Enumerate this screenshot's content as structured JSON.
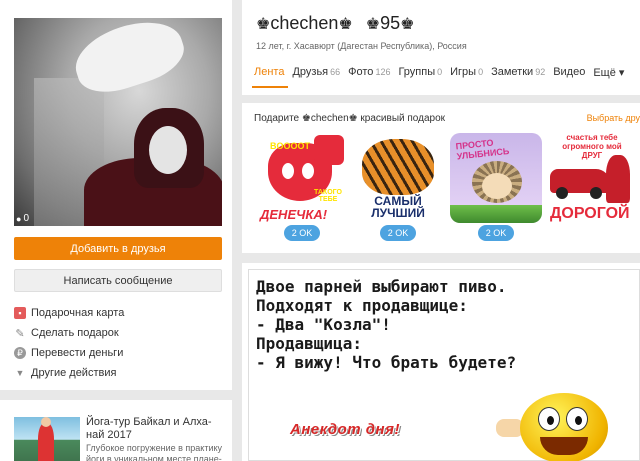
{
  "profile_photo": {
    "photo_count": "0"
  },
  "left_panel": {
    "add_friend_label": "Добавить в друзья",
    "write_message_label": "Написать сообщение",
    "actions": [
      {
        "label": "Подарочная карта",
        "icon": "gift-card-icon"
      },
      {
        "label": "Сделать подарок",
        "icon": "pencil-icon"
      },
      {
        "label": "Перевести деньги",
        "icon": "coin-icon"
      },
      {
        "label": "Другие действия",
        "icon": "chevron-down-icon"
      }
    ]
  },
  "ad": {
    "title": "Йога-тур Байкал и Алха-най 2017",
    "description": "Глубокое погружение в практику йоги в уникальном месте плане-"
  },
  "user": {
    "crown": "♚",
    "name": "chechen",
    "age_number": "95",
    "info": "12 лет, г. Хасавюрт (Дагестан Республика), Россия"
  },
  "nav": {
    "tabs": [
      {
        "label": "Лента",
        "count": ""
      },
      {
        "label": "Друзья",
        "count": "66"
      },
      {
        "label": "Фото",
        "count": "126"
      },
      {
        "label": "Группы",
        "count": "0"
      },
      {
        "label": "Игры",
        "count": "0"
      },
      {
        "label": "Заметки",
        "count": "92"
      },
      {
        "label": "Видео",
        "count": ""
      },
      {
        "label": "Ещё ▾",
        "count": ""
      }
    ]
  },
  "gifts": {
    "heading_prefix": "Подарите ",
    "heading_crown": "♚",
    "heading_name": "chechen",
    "heading_suffix": " красивый подарок",
    "choose_label": "Выбрать дру",
    "items": [
      {
        "top": "BOOOOT",
        "middle": "ТАКОГО ТЕБЕ",
        "bottom": "ДЕНЕЧКА!",
        "price": "2 OK"
      },
      {
        "top": "",
        "middle": "САМЫЙ",
        "bottom": "ЛУЧШИЙ",
        "price": "2 OK"
      },
      {
        "top": "ПРОСТО УЛЫБНИСЬ",
        "middle": "",
        "bottom": "",
        "price": "2 OK"
      },
      {
        "top": "счастья тебе огромного мой ДРУГ",
        "middle": "",
        "bottom": "ДОРОГОЙ",
        "price": ""
      }
    ]
  },
  "post": {
    "lines": [
      "Двое парней выбирают пиво.",
      "Подходят к продавщице:",
      "- Два \"Козла\"!",
      "Продавщица:",
      "- Я вижу! Что брать будете?"
    ],
    "caption": "Анекдот дня!"
  }
}
